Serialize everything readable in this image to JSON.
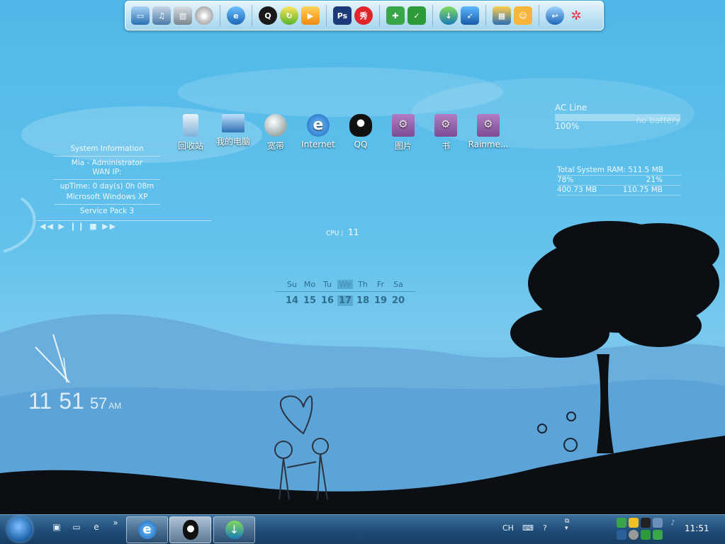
{
  "desktop_icons": [
    {
      "label": "回收站",
      "icon": "recycle-bin-icon"
    },
    {
      "label": "我的电脑",
      "icon": "my-computer-icon"
    },
    {
      "label": "宽带",
      "icon": "broadband-icon"
    },
    {
      "label": "Internet",
      "icon": "ie-icon"
    },
    {
      "label": "QQ",
      "icon": "qq-icon"
    },
    {
      "label": "图片",
      "icon": "folder-icon"
    },
    {
      "label": "书",
      "icon": "folder-icon"
    },
    {
      "label": "Rainme...",
      "icon": "folder-icon"
    }
  ],
  "sysinfo": {
    "title": "System Information",
    "user": "Mia - Administrator",
    "wan": "WAN IP:",
    "uptime": "upTime: 0 day(s) 0h 08m",
    "os": "Microsoft Windows XP",
    "sp": "Service Pack 3"
  },
  "media_controls": "◀◀ ▶ ❙❙ ■ ▶▶",
  "cpu": {
    "label": "CPU",
    "value": "11"
  },
  "calendar": {
    "days": [
      "Su",
      "Mo",
      "Tu",
      "We",
      "Th",
      "Fr",
      "Sa"
    ],
    "dates": [
      "14",
      "15",
      "16",
      "17",
      "18",
      "19",
      "20"
    ]
  },
  "battery": {
    "source": "AC Line",
    "percent": "100%",
    "status": "no battery"
  },
  "ram": {
    "total": "Total System RAM:  511.5 MB",
    "used_pct": "78%",
    "free_pct": "21%",
    "used": "400.73 MB",
    "free": "110.75 MB"
  },
  "clock": {
    "hour": "11",
    "minute": "51",
    "second": "57",
    "ampm": "AM"
  },
  "taskbar": {
    "lang": "CH",
    "time": "11:51",
    "more": "»"
  },
  "colors": {
    "sky": "#4fb8e8",
    "taskbar": "#1f4c77"
  }
}
